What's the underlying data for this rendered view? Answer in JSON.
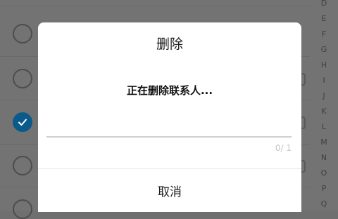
{
  "dialog": {
    "title": "删除",
    "message": "正在删除联系人...",
    "progress": {
      "current": 0,
      "total": 1,
      "label": "0/ 1"
    },
    "cancel_label": "取消"
  },
  "index_bar": [
    "D",
    "E",
    "F",
    "G",
    "H",
    "I",
    "J",
    "K",
    "L",
    "M",
    "N",
    "O",
    "P",
    "Q"
  ],
  "colors": {
    "accent": "#0a5a8a",
    "overlay": "#737373",
    "dialog_bg": "#ffffff"
  }
}
